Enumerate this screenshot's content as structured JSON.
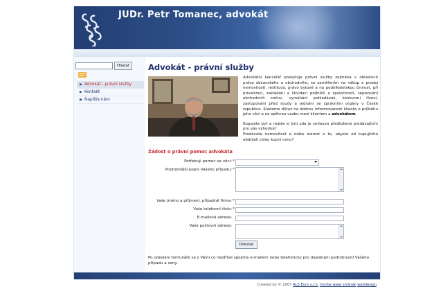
{
  "header": {
    "title": "JUDr. Petr  Tomanec, advokát"
  },
  "search": {
    "value": "",
    "button_label": "Hledat"
  },
  "sidebar": {
    "items": [
      {
        "label": "Advokát - právní služby",
        "active": true
      },
      {
        "label": "Kontakt",
        "active": false
      },
      {
        "label": "Napište nám",
        "active": false
      }
    ]
  },
  "main": {
    "title": "Advokát - právní služby",
    "intro_p1_start": "Advokátní kancelář poskytuje právní služby zejména v oblastech práva občanského a obchodního, se zaměřením na nákup a prodej nemovitostí, restituce, právo bytové a na podnikatelskou činnost, při privatizaci, zakládání a likvidaci podniků a společností, sepisování obchodních smluv, vymáhání pohledávek, konkurzní řízení, zastupování před soudy a jednání se správními orgány v České republice. Klademe důraz na dobrou informovanost klienta o průběhu jeho věci a na zpětnou vazbu mezi klientem a ",
    "intro_p1_bold": "advokátem",
    "intro_p1_end": ".",
    "intro_p2": "Kupujete byt a nejste si jisti zda je smlouva předložená prodávajícím pro vás výhodná?",
    "intro_p3": "Prodáváte nemovitost a máte starost o to, abyste od kupujícího obdrželi celou kupní cenu?"
  },
  "form": {
    "title": "Žádost o právní pomoc advokáta",
    "required_mark": "*",
    "labels": {
      "topic": "Potřebuji pomoc ve věci:",
      "details": "Podrobnější popis Vašeho případu:",
      "name": "Vaše jméno a příjmení, případně firma:",
      "phone": "Vaše telefonní číslo:",
      "email": "E-mailová adresa:",
      "address": "Vaše poštovní adresa:"
    },
    "topic_value": "",
    "submit_label": "Odeslat",
    "note": "Po odeslání formuláře se s Vámi co nejdříve spojíme e-mailem nebo telefonicky pro dojednání podrobností Vašeho případu a ceny."
  },
  "footer": {
    "prefix": "Created by © 2007 ",
    "link1": "ALS Euro s.r.o.",
    "sep": " ",
    "link2": "tvorba www stránek",
    "sep2": " ",
    "link3": "webdesign"
  },
  "colors": {
    "brand_navy": "#1f2f6b",
    "accent_red": "#c1272d",
    "header_blue": "#2c4d86"
  }
}
